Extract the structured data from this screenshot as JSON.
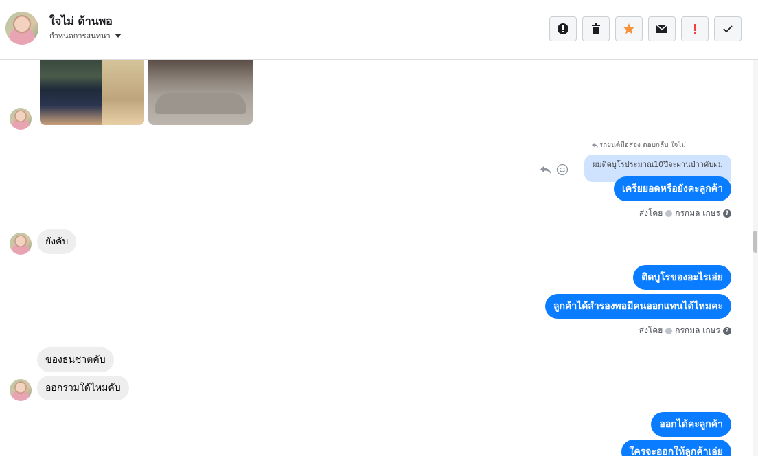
{
  "header": {
    "name": "ใจไม่ ด้านพอ",
    "subtitle": "กำหนดการสนทนา"
  },
  "toolbar": {
    "buttons": [
      {
        "icon": "exclamation-circle-icon",
        "color": "#1c1e21"
      },
      {
        "icon": "trash-icon",
        "color": "#1c1e21"
      },
      {
        "icon": "star-icon",
        "color": "#f7923b"
      },
      {
        "icon": "envelope-icon",
        "color": "#1c1e21"
      },
      {
        "icon": "exclamation-mark-icon",
        "color": "#fa3e3e"
      },
      {
        "icon": "check-icon",
        "color": "#1c1e21"
      }
    ]
  },
  "conversation": {
    "reply_label": "รถยนต์มือสอง ตอบกลับ ใจไม่",
    "quoted_text": "ผมติดบูโรประมาณ10ปีจะผ่านป่าวคับผม",
    "messages": [
      {
        "side": "out",
        "text": "เครียยอดหรือยังคะลูกค้า"
      },
      {
        "side": "in",
        "text": "ยังคับ"
      },
      {
        "side": "out",
        "text": "ติดบูโรของอะไรเอ่ย"
      },
      {
        "side": "out",
        "text": "ลูกค้าได้สำรองพอมีคนออกแทนได้ไหมคะ"
      },
      {
        "side": "in",
        "text": "ของธนชาตคับ"
      },
      {
        "side": "in",
        "text": "ออกรวมใด้ไหมคับ"
      },
      {
        "side": "out",
        "text": "ออกได้คะลูกค้า"
      },
      {
        "side": "out",
        "text": "ใครจะออกให้ลูกค้าเอ่ย"
      }
    ],
    "sent_by": {
      "prefix": "ส่งโดย",
      "agent": "กรกมล เกษร"
    }
  },
  "colors": {
    "outgoing_bubble": "#0a7cff",
    "incoming_bubble": "#eeeeef",
    "quote_bubble": "#cfe3ff"
  }
}
